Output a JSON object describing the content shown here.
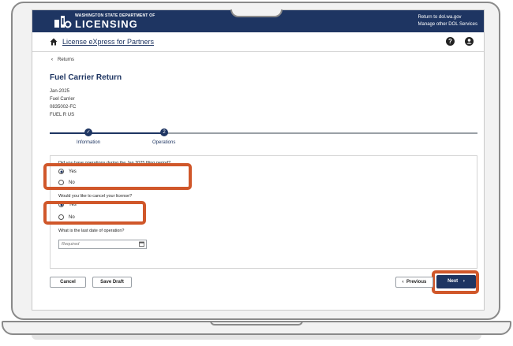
{
  "agency": {
    "small_text": "WASHINGTON STATE DEPARTMENT OF",
    "big_text": "LICENSING"
  },
  "top_links": {
    "return": "Return to dol.wa.gov",
    "manage": "Manage other DOL Services"
  },
  "app": {
    "title": "License eXpress for Partners",
    "help_glyph": "?"
  },
  "breadcrumb": {
    "back_label": "Returns"
  },
  "page": {
    "title": "Fuel Carrier Return",
    "meta": [
      "Jan-2025",
      "Fuel Carrier",
      "0835002-FC",
      "FUEL R US"
    ]
  },
  "stepper": {
    "steps": [
      {
        "label": "Information",
        "state": "complete",
        "glyph": "✓"
      },
      {
        "label": "Operations",
        "state": "current",
        "glyph": "2"
      }
    ]
  },
  "form": {
    "q1": {
      "text": "Did you have operations during the Jan 2025 filing period?",
      "options": [
        {
          "label": "Yes",
          "selected": true
        },
        {
          "label": "No",
          "selected": false
        }
      ]
    },
    "q2": {
      "text": "Would you like to cancel your license?",
      "options": [
        {
          "label": "Yes",
          "selected": true
        },
        {
          "label": "No",
          "selected": false
        }
      ]
    },
    "q3": {
      "text": "What is the last date of operation?",
      "placeholder": "Required"
    }
  },
  "footer": {
    "cancel": "Cancel",
    "save_draft": "Save Draft",
    "previous": "Previous",
    "next": "Next"
  },
  "colors": {
    "navy": "#1e3562",
    "highlight": "#d0572a"
  }
}
